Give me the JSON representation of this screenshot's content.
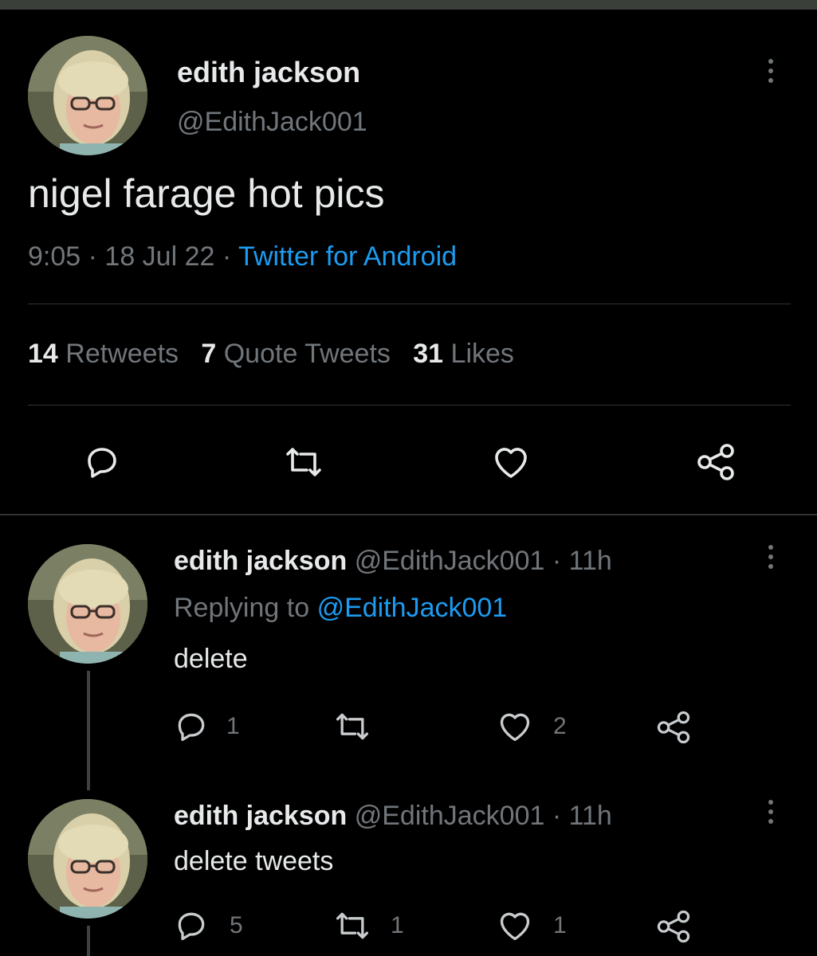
{
  "main_tweet": {
    "author_name": "edith jackson",
    "handle": "@EdithJack001",
    "text": "nigel farage hot pics",
    "time": "9:05",
    "date": "18 Jul 22",
    "separator": "·",
    "source": "Twitter for Android",
    "stats": {
      "retweets_count": "14",
      "retweets_label": "Retweets",
      "quotes_count": "7",
      "quotes_label": "Quote Tweets",
      "likes_count": "31",
      "likes_label": "Likes"
    },
    "actions": [
      "reply-icon",
      "retweet-icon",
      "like-icon",
      "share-icon"
    ]
  },
  "replies": [
    {
      "author_name": "edith jackson",
      "handle": "@EdithJack001",
      "separator": "·",
      "time_ago": "11h",
      "replying_to_label": "Replying to",
      "replying_to_handle": "@EdithJack001",
      "text": "delete",
      "reply_count": "1",
      "retweet_count": "",
      "like_count": "2"
    },
    {
      "author_name": "edith jackson",
      "handle": "@EdithJack001",
      "separator": "·",
      "time_ago": "11h",
      "text": "delete tweets",
      "reply_count": "5",
      "retweet_count": "1",
      "like_count": "1"
    }
  ],
  "colors": {
    "background": "#000000",
    "text": "#e7e9ea",
    "muted": "#71767b",
    "link": "#1d9bf0",
    "divider": "#2f3336"
  }
}
